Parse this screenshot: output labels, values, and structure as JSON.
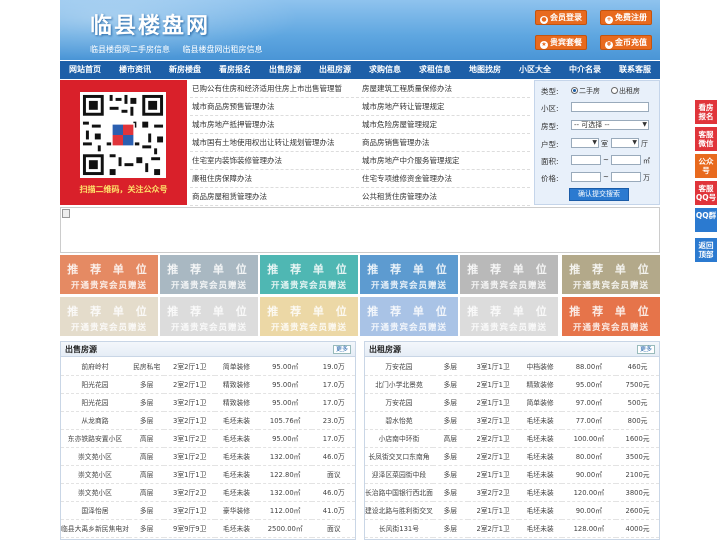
{
  "header": {
    "title": "临县楼盘网",
    "sub_links": [
      "临县楼盘网二手房信息",
      "临县楼盘网出租房信息"
    ],
    "buttons": {
      "login": "会员登录",
      "register": "免费注册",
      "vip": "贵宾套餐",
      "recharge": "金币充值"
    }
  },
  "nav": [
    "网站首页",
    "楼市资讯",
    "新房楼盘",
    "看房报名",
    "出售房源",
    "出租房源",
    "求购信息",
    "求租信息",
    "地图找房",
    "小区大全",
    "中介名录",
    "联系客服"
  ],
  "qr": {
    "caption": "扫描二维码，关注公众号"
  },
  "news_links": [
    [
      "已购公有住房和经济适用住房上市出售管理暂",
      "房屋建筑工程质量保修办法"
    ],
    [
      "城市商品房预售管理办法",
      "城市房地产转让管理规定"
    ],
    [
      "城市房地产抵押管理办法",
      "城市危险房屋管理规定"
    ],
    [
      "城市国有土地使用权出让转让规划管理办法",
      "商品房销售管理办法"
    ],
    [
      "住宅室内装饰装修管理办法",
      "城市房地产中介服务管理规定"
    ],
    [
      "廉租住房保障办法",
      "住宅专项维修资金管理办法"
    ],
    [
      "商品房屋租赁管理办法",
      "公共租赁住房管理办法"
    ]
  ],
  "search": {
    "type_label": "类型:",
    "type_options": [
      "二手房",
      "出租房"
    ],
    "area_label": "小区:",
    "area_placeholder": "",
    "housetype_label": "房型:",
    "housetype_value": "-- 可选择 --",
    "layout_label": "户型:",
    "room_unit": "室",
    "hall_unit": "厅",
    "size_label": "面积:",
    "size_unit": "㎡",
    "price_label": "价格:",
    "price_unit": "万",
    "range_sep": "~",
    "submit": "确认提交搜索"
  },
  "ads": {
    "title": "推 荐 单 位",
    "subtitle": "开通贵宾会员赠送",
    "colors": [
      "#e58a63",
      "#a9b8c2",
      "#4fb7b3",
      "#5d9bd0",
      "#b9b9b9",
      "#b3a98a",
      "#e4dccb",
      "#dcdcdc",
      "#ecd8a6",
      "#a9c3e6",
      "#dcdcdc",
      "#e6744a"
    ]
  },
  "sale": {
    "title": "出售房源",
    "more": "更多",
    "rows": [
      [
        "前府岭村",
        "民房私宅",
        "2室2厅1卫",
        "简单装修",
        "95.00㎡",
        "19.0万"
      ],
      [
        "阳光花园",
        "多层",
        "2室2厅1卫",
        "精致装修",
        "95.00㎡",
        "17.0万"
      ],
      [
        "阳光花园",
        "多层",
        "3室2厅1卫",
        "精致装修",
        "95.00㎡",
        "17.0万"
      ],
      [
        "从龙商路",
        "多层",
        "3室2厅1卫",
        "毛坯未装",
        "105.76㎡",
        "23.0万"
      ],
      [
        "东亦铁路安置小区",
        "高层",
        "3室1厅2卫",
        "毛坯未装",
        "95.00㎡",
        "17.0万"
      ],
      [
        "崇文苑小区",
        "高层",
        "3室1厅2卫",
        "毛坯未装",
        "132.00㎡",
        "46.0万"
      ],
      [
        "崇文苑小区",
        "高层",
        "3室1厅1卫",
        "毛坯未装",
        "122.80㎡",
        "面议"
      ],
      [
        "崇文苑小区",
        "高层",
        "3室2厅2卫",
        "毛坯未装",
        "132.00㎡",
        "46.0万"
      ],
      [
        "国泽怡居",
        "多层",
        "3室2厅1卫",
        "豪华装修",
        "112.00㎡",
        "41.0万"
      ],
      [
        "临县大禹乡新民焦电对",
        "多层",
        "9室9厅9卫",
        "毛坯未装",
        "2500.00㎡",
        "面议"
      ]
    ]
  },
  "rent": {
    "title": "出租房源",
    "more": "更多",
    "rows": [
      [
        "万安花园",
        "多层",
        "3室1厅1卫",
        "中档装修",
        "88.00㎡",
        "460元"
      ],
      [
        "北门小学北景苑",
        "多层",
        "2室1厅1卫",
        "精致装修",
        "95.00㎡",
        "7500元"
      ],
      [
        "万安花园",
        "多层",
        "2室1厅1卫",
        "简单装修",
        "97.00㎡",
        "500元"
      ],
      [
        "碧水怡苑",
        "多层",
        "3室2厅1卫",
        "毛坯未装",
        "77.00㎡",
        "800元"
      ],
      [
        "小店南中环街",
        "高层",
        "2室2厅1卫",
        "毛坯未装",
        "100.00㎡",
        "1600元"
      ],
      [
        "长凤街交叉口东南角",
        "多层",
        "2室2厅1卫",
        "毛坯未装",
        "80.00㎡",
        "3500元"
      ],
      [
        "迎泽区菜园街中段",
        "多层",
        "2室1厅1卫",
        "毛坯未装",
        "90.00㎡",
        "2100元"
      ],
      [
        "长治路中国银行西北面",
        "多层",
        "3室2厅2卫",
        "毛坯未装",
        "120.00㎡",
        "3800元"
      ],
      [
        "建设北路与胜利街交叉",
        "多层",
        "2室1厅1卫",
        "毛坯未装",
        "90.00㎡",
        "2600元"
      ],
      [
        "长风街131号",
        "多层",
        "2室2厅1卫",
        "毛坯未装",
        "128.00㎡",
        "4000元"
      ]
    ]
  },
  "side": [
    {
      "label": "看房报名",
      "color": "#e0343a"
    },
    {
      "label": "客服微信",
      "color": "#e0343a"
    },
    {
      "label": "公众号",
      "color": "#e86a1e"
    },
    {
      "label": "客服QQ号",
      "color": "#e0343a"
    },
    {
      "label": "QQ群",
      "color": "#2b7ad0"
    },
    {
      "label": "返回顶部",
      "color": "#2b7ad0"
    }
  ]
}
